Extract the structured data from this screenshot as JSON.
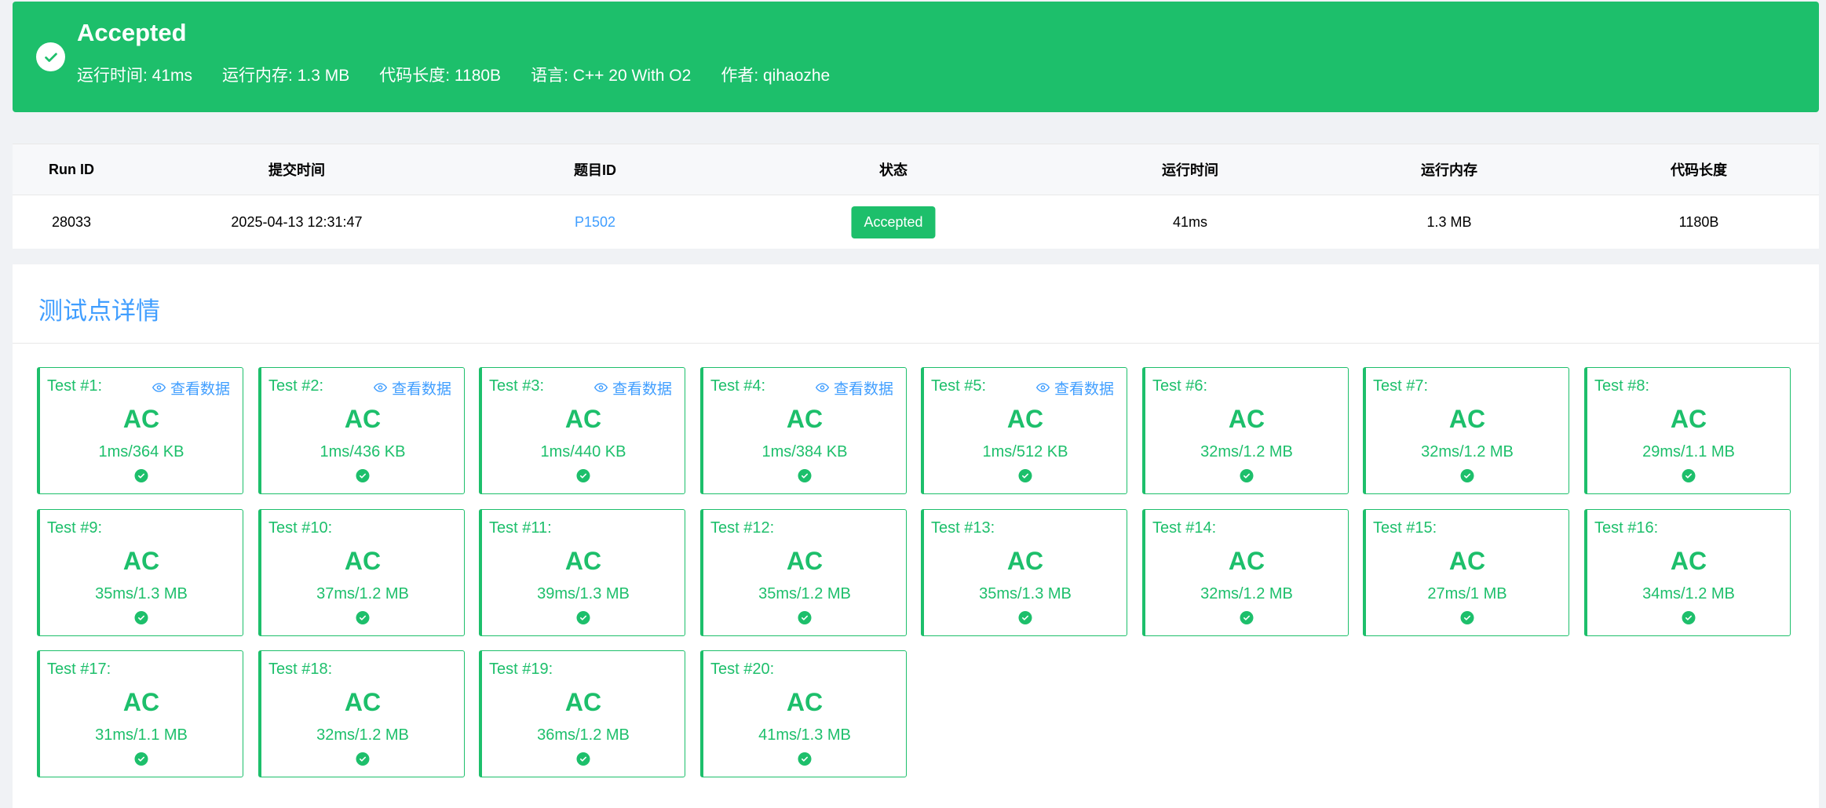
{
  "banner": {
    "status_title": "Accepted",
    "metrics": [
      "运行时间: 41ms",
      "运行内存: 1.3 MB",
      "代码长度: 1180B",
      "语言: C++ 20 With O2",
      "作者: qihaozhe"
    ],
    "color": "#1dbf6b"
  },
  "summary": {
    "headers": [
      "Run ID",
      "提交时间",
      "题目ID",
      "状态",
      "运行时间",
      "运行内存",
      "代码长度"
    ],
    "row": {
      "run_id": "28033",
      "submit_time": "2025-04-13 12:31:47",
      "problem_id": "P1502",
      "status": "Accepted",
      "time": "41ms",
      "memory": "1.3 MB",
      "length": "1180B"
    }
  },
  "details": {
    "title": "测试点详情",
    "view_label": "查看数据",
    "tests": [
      {
        "label": "Test #1:",
        "status": "AC",
        "stats": "1ms/364 KB",
        "viewable": true
      },
      {
        "label": "Test #2:",
        "status": "AC",
        "stats": "1ms/436 KB",
        "viewable": true
      },
      {
        "label": "Test #3:",
        "status": "AC",
        "stats": "1ms/440 KB",
        "viewable": true
      },
      {
        "label": "Test #4:",
        "status": "AC",
        "stats": "1ms/384 KB",
        "viewable": true
      },
      {
        "label": "Test #5:",
        "status": "AC",
        "stats": "1ms/512 KB",
        "viewable": true
      },
      {
        "label": "Test #6:",
        "status": "AC",
        "stats": "32ms/1.2 MB",
        "viewable": false
      },
      {
        "label": "Test #7:",
        "status": "AC",
        "stats": "32ms/1.2 MB",
        "viewable": false
      },
      {
        "label": "Test #8:",
        "status": "AC",
        "stats": "29ms/1.1 MB",
        "viewable": false
      },
      {
        "label": "Test #9:",
        "status": "AC",
        "stats": "35ms/1.3 MB",
        "viewable": false
      },
      {
        "label": "Test #10:",
        "status": "AC",
        "stats": "37ms/1.2 MB",
        "viewable": false
      },
      {
        "label": "Test #11:",
        "status": "AC",
        "stats": "39ms/1.3 MB",
        "viewable": false
      },
      {
        "label": "Test #12:",
        "status": "AC",
        "stats": "35ms/1.2 MB",
        "viewable": false
      },
      {
        "label": "Test #13:",
        "status": "AC",
        "stats": "35ms/1.3 MB",
        "viewable": false
      },
      {
        "label": "Test #14:",
        "status": "AC",
        "stats": "32ms/1.2 MB",
        "viewable": false
      },
      {
        "label": "Test #15:",
        "status": "AC",
        "stats": "27ms/1 MB",
        "viewable": false
      },
      {
        "label": "Test #16:",
        "status": "AC",
        "stats": "34ms/1.2 MB",
        "viewable": false
      },
      {
        "label": "Test #17:",
        "status": "AC",
        "stats": "31ms/1.1 MB",
        "viewable": false
      },
      {
        "label": "Test #18:",
        "status": "AC",
        "stats": "32ms/1.2 MB",
        "viewable": false
      },
      {
        "label": "Test #19:",
        "status": "AC",
        "stats": "36ms/1.2 MB",
        "viewable": false
      },
      {
        "label": "Test #20:",
        "status": "AC",
        "stats": "41ms/1.3 MB",
        "viewable": false
      }
    ]
  }
}
